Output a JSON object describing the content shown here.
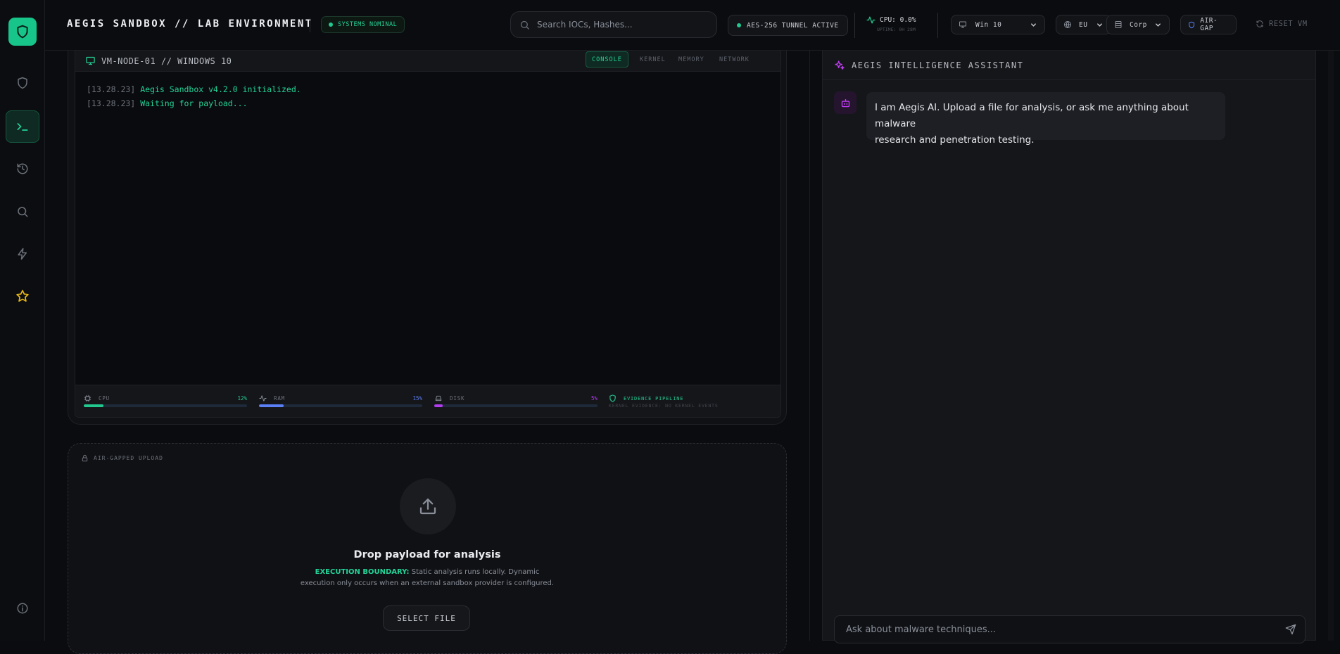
{
  "header": {
    "brand": "AEGIS SANDBOX // LAB ENVIRONMENT",
    "systems_status": "SYSTEMS NOMINAL",
    "search_placeholder": "Search IOCs, Hashes...",
    "tunnel_status": "AES-256 TUNNEL ACTIVE",
    "cpu_readout": "CPU: 0.0%",
    "uptime": "UPTIME: 0H 28M",
    "os_select": "Win 10",
    "region_select": "EU",
    "network_select": "Corp",
    "airgap_label": "AIR-GAP",
    "reset_label": "RESET VM"
  },
  "sidebar": {
    "items": [
      {
        "icon": "shield-icon"
      },
      {
        "icon": "terminal-icon",
        "active": true
      },
      {
        "icon": "history-icon"
      },
      {
        "icon": "search-icon"
      },
      {
        "icon": "lightning-icon"
      },
      {
        "icon": "star-icon"
      }
    ],
    "bottom_icon": "info-icon"
  },
  "vm": {
    "title": "VM-NODE-01 // WINDOWS 10",
    "tabs": [
      "CONSOLE",
      "KERNEL",
      "MEMORY",
      "NETWORK"
    ],
    "active_tab": "CONSOLE",
    "console": [
      {
        "ts": "[13.28.23]",
        "msg": "Aegis Sandbox v4.2.0 initialized."
      },
      {
        "ts": "[13.28.23]",
        "msg": "Waiting for payload..."
      }
    ],
    "stats": {
      "cpu": {
        "label": "CPU",
        "value": "12%",
        "percent": 12,
        "color": "#22c98f"
      },
      "ram": {
        "label": "RAM",
        "value": "15%",
        "percent": 15,
        "color": "#5b7ff5"
      },
      "disk": {
        "label": "DISK",
        "value": "5%",
        "percent": 5,
        "color": "#b23cf0"
      },
      "evidence": {
        "label": "EVIDENCE PIPELINE",
        "sub": "KERNEL EVIDENCE: NO KERNEL EVENTS"
      }
    }
  },
  "upload": {
    "label": "AIR-GAPPED UPLOAD",
    "title": "Drop payload for analysis",
    "boundary_label": "EXECUTION BOUNDARY:",
    "boundary_text_1": "Static analysis runs locally. Dynamic",
    "boundary_text_2": "execution only occurs when an external sandbox provider is configured.",
    "button": "SELECT FILE"
  },
  "assistant": {
    "title": "AEGIS INTELLIGENCE ASSISTANT",
    "message_line_1": "I am Aegis AI. Upload a file for analysis, or ask me anything about malware",
    "message_line_2": "research and penetration testing.",
    "input_placeholder": "Ask about malware techniques..."
  },
  "colors": {
    "accent": "#22c98f",
    "ram": "#5b7ff5",
    "disk": "#b23cf0",
    "ai": "#c23cf5",
    "star": "#e8b715"
  }
}
